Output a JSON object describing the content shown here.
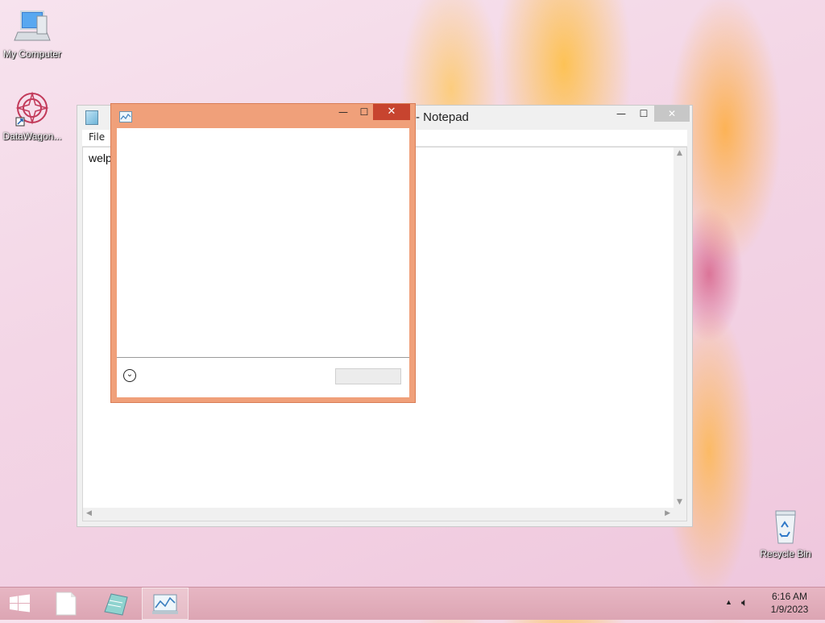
{
  "desktop": {
    "icons": [
      {
        "label": "My Computer"
      },
      {
        "label": "DataWagon..."
      },
      {
        "label": "Recycle Bin"
      }
    ]
  },
  "notepad": {
    "title": "- Notepad",
    "menu": {
      "file": "File"
    },
    "content": "welp",
    "controls": {
      "minimize": "—",
      "maximize": "☐",
      "close": "✕"
    }
  },
  "dialog": {
    "controls": {
      "minimize": "—",
      "maximize": "☐",
      "close": "✕"
    },
    "button_label": ""
  },
  "taskbar": {
    "clock_time": "6:16 AM",
    "clock_date": "1/9/2023"
  },
  "colors": {
    "dialog_frame": "#f0a07a",
    "close_red": "#c7442f",
    "taskbar": "#dca5b3"
  }
}
